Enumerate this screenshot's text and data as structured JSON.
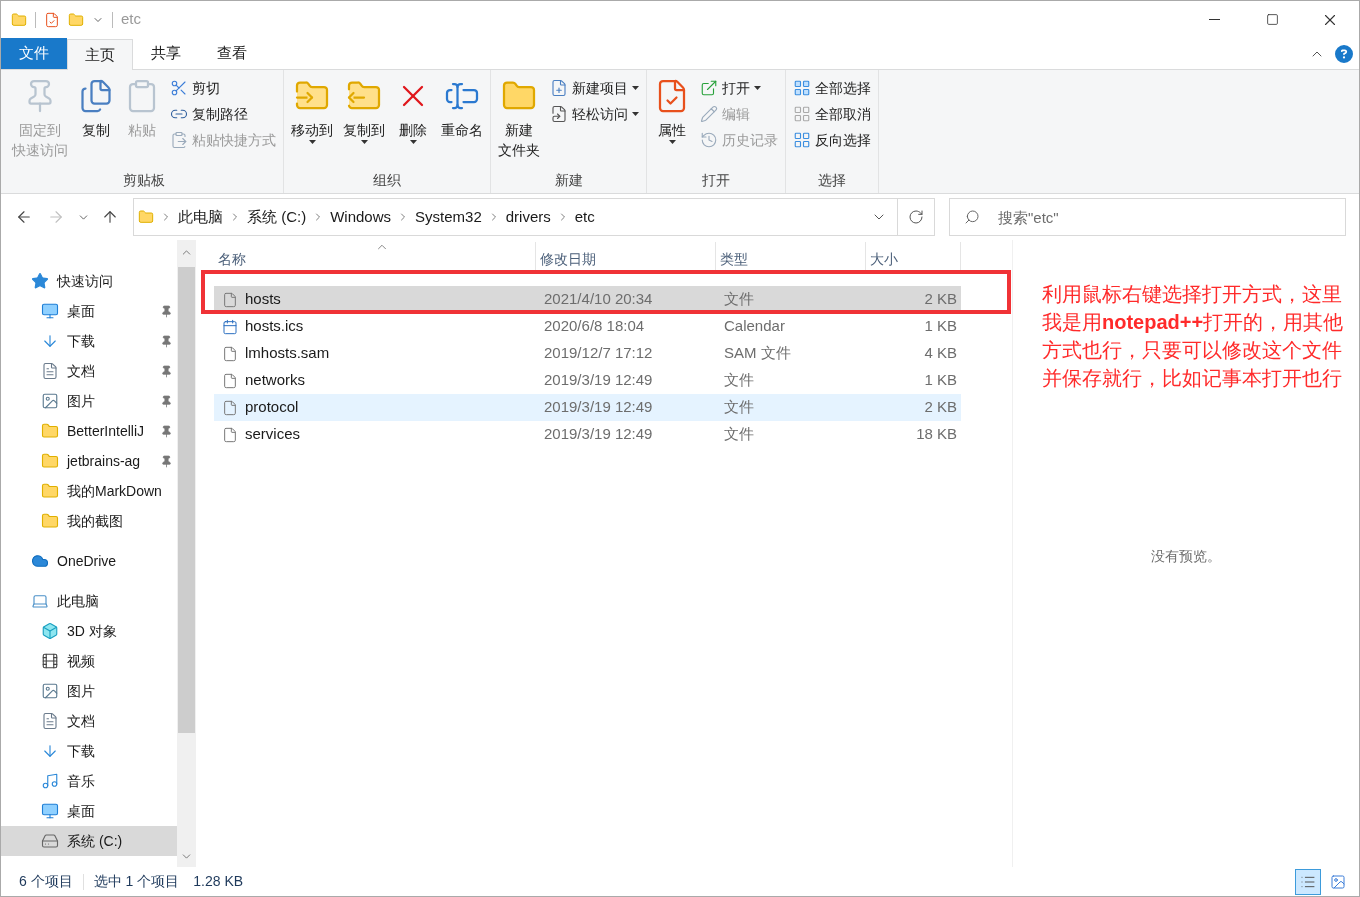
{
  "title_bar": {
    "title": "etc"
  },
  "ribbon_tabs": [
    {
      "label": "文件",
      "kind": "file",
      "selected": false
    },
    {
      "label": "主页",
      "kind": "tab",
      "selected": true
    },
    {
      "label": "共享",
      "kind": "tab",
      "selected": false
    },
    {
      "label": "查看",
      "kind": "tab",
      "selected": false
    }
  ],
  "ribbon_groups": [
    {
      "label": "剪贴板",
      "items": [
        {
          "kind": "large",
          "lines": [
            "固定到",
            "快速访问"
          ],
          "disabled": true,
          "dropdown": false
        },
        {
          "kind": "large",
          "lines": [
            "复制"
          ],
          "disabled": false,
          "dropdown": false
        },
        {
          "kind": "large",
          "lines": [
            "粘贴"
          ],
          "disabled": true,
          "dropdown": false
        },
        {
          "kind": "stack",
          "items": [
            {
              "label": "剪切",
              "disabled": false,
              "dropdown": false
            },
            {
              "label": "复制路径",
              "disabled": false,
              "dropdown": false
            },
            {
              "label": "粘贴快捷方式",
              "disabled": true,
              "dropdown": false
            }
          ]
        }
      ]
    },
    {
      "label": "组织",
      "items": [
        {
          "kind": "large",
          "lines": [
            "移动到"
          ],
          "disabled": false,
          "dropdown": true
        },
        {
          "kind": "large",
          "lines": [
            "复制到"
          ],
          "disabled": false,
          "dropdown": true
        },
        {
          "kind": "large",
          "lines": [
            "删除"
          ],
          "disabled": false,
          "dropdown": true
        },
        {
          "kind": "large",
          "lines": [
            "重命名"
          ],
          "disabled": false,
          "dropdown": false
        }
      ]
    },
    {
      "label": "新建",
      "items": [
        {
          "kind": "large",
          "lines": [
            "新建",
            "文件夹"
          ],
          "disabled": false,
          "dropdown": false
        },
        {
          "kind": "stack",
          "items": [
            {
              "label": "新建项目",
              "disabled": false,
              "dropdown": true
            },
            {
              "label": "轻松访问",
              "disabled": false,
              "dropdown": true
            }
          ]
        }
      ]
    },
    {
      "label": "打开",
      "items": [
        {
          "kind": "large",
          "lines": [
            "属性"
          ],
          "disabled": false,
          "dropdown": true
        },
        {
          "kind": "stack",
          "items": [
            {
              "label": "打开",
              "disabled": false,
              "dropdown": true
            },
            {
              "label": "编辑",
              "disabled": true,
              "dropdown": false
            },
            {
              "label": "历史记录",
              "disabled": true,
              "dropdown": false
            }
          ]
        }
      ]
    },
    {
      "label": "选择",
      "items": [
        {
          "kind": "stack",
          "items": [
            {
              "label": "全部选择",
              "disabled": false,
              "dropdown": false
            },
            {
              "label": "全部取消",
              "disabled": false,
              "dropdown": false
            },
            {
              "label": "反向选择",
              "disabled": false,
              "dropdown": false
            }
          ]
        }
      ]
    }
  ],
  "nav_buttons": [
    {
      "kind": "back",
      "disabled": false
    },
    {
      "kind": "forward",
      "disabled": true
    },
    {
      "kind": "recent",
      "disabled": false
    },
    {
      "kind": "up",
      "disabled": false
    }
  ],
  "address_bar": {
    "segments": [
      "此电脑",
      "系统 (C:)",
      "Windows",
      "System32",
      "drivers",
      "etc"
    ]
  },
  "search": {
    "placeholder": "搜索\"etc\""
  },
  "navigation": [
    {
      "label": "快速访问",
      "kind": "star",
      "selected": false,
      "children": [
        {
          "label": "桌面",
          "kind": "desktop",
          "pinned": true,
          "selected": false
        },
        {
          "label": "下载",
          "kind": "downloads",
          "pinned": true,
          "selected": false
        },
        {
          "label": "文档",
          "kind": "documents",
          "pinned": true,
          "selected": false
        },
        {
          "label": "图片",
          "kind": "pictures",
          "pinned": true,
          "selected": false
        },
        {
          "label": "BetterIntelliJ",
          "kind": "folder",
          "pinned": true,
          "selected": false
        },
        {
          "label": "jetbrains-ag",
          "kind": "folder",
          "pinned": true,
          "selected": false
        },
        {
          "label": "我的MarkDown",
          "kind": "folder",
          "pinned": false,
          "selected": false
        },
        {
          "label": "我的截图",
          "kind": "folder",
          "pinned": false,
          "selected": false
        }
      ]
    },
    {
      "label": "OneDrive",
      "kind": "cloud",
      "selected": false
    },
    {
      "label": "此电脑",
      "kind": "computer",
      "selected": false,
      "children": [
        {
          "label": "3D 对象",
          "kind": "objects",
          "pinned": false,
          "selected": false
        },
        {
          "label": "视频",
          "kind": "videos",
          "pinned": false,
          "selected": false
        },
        {
          "label": "图片",
          "kind": "pictures",
          "pinned": false,
          "selected": false
        },
        {
          "label": "文档",
          "kind": "documents",
          "pinned": false,
          "selected": false
        },
        {
          "label": "下载",
          "kind": "downloads",
          "pinned": false,
          "selected": false
        },
        {
          "label": "音乐",
          "kind": "music",
          "pinned": false,
          "selected": false
        },
        {
          "label": "桌面",
          "kind": "desktop",
          "pinned": false,
          "selected": false
        },
        {
          "label": "系统 (C:)",
          "kind": "drive",
          "pinned": false,
          "selected": true
        }
      ]
    }
  ],
  "file_list": {
    "columns": [
      {
        "label": "名称",
        "sorted": true
      },
      {
        "label": "修改日期",
        "sorted": false
      },
      {
        "label": "类型",
        "sorted": false
      },
      {
        "label": "大小",
        "sorted": false
      }
    ],
    "rows": [
      {
        "name": "hosts",
        "kind": "file",
        "modified": "2021/4/10 20:34",
        "type": "文件",
        "size": "2 KB",
        "selected": true,
        "hovered": false
      },
      {
        "name": "hosts.ics",
        "kind": "calendar",
        "modified": "2020/6/8 18:04",
        "type": "Calendar",
        "size": "1 KB",
        "selected": false,
        "hovered": false
      },
      {
        "name": "lmhosts.sam",
        "kind": "file",
        "modified": "2019/12/7 17:12",
        "type": "SAM 文件",
        "size": "4 KB",
        "selected": false,
        "hovered": false
      },
      {
        "name": "networks",
        "kind": "file",
        "modified": "2019/3/19 12:49",
        "type": "文件",
        "size": "1 KB",
        "selected": false,
        "hovered": false
      },
      {
        "name": "protocol",
        "kind": "file",
        "modified": "2019/3/19 12:49",
        "type": "文件",
        "size": "2 KB",
        "selected": false,
        "hovered": true
      },
      {
        "name": "services",
        "kind": "file",
        "modified": "2019/3/19 12:49",
        "type": "文件",
        "size": "18 KB",
        "selected": false,
        "hovered": false
      }
    ]
  },
  "annotation": {
    "text": "利用鼠标右键选择打开方式，这里我是用**notepad++**打开的，用其他方式也行，只要可以修改这个文件并保存就行，比如记事本打开也行"
  },
  "preview": {
    "message": "没有预览。"
  },
  "status_bar": {
    "item_count": "6 个项目",
    "selection": "选中 1 个项目",
    "size": "1.28 KB",
    "views": [
      {
        "kind": "details",
        "selected": true
      },
      {
        "kind": "large_icons",
        "selected": false
      }
    ]
  }
}
